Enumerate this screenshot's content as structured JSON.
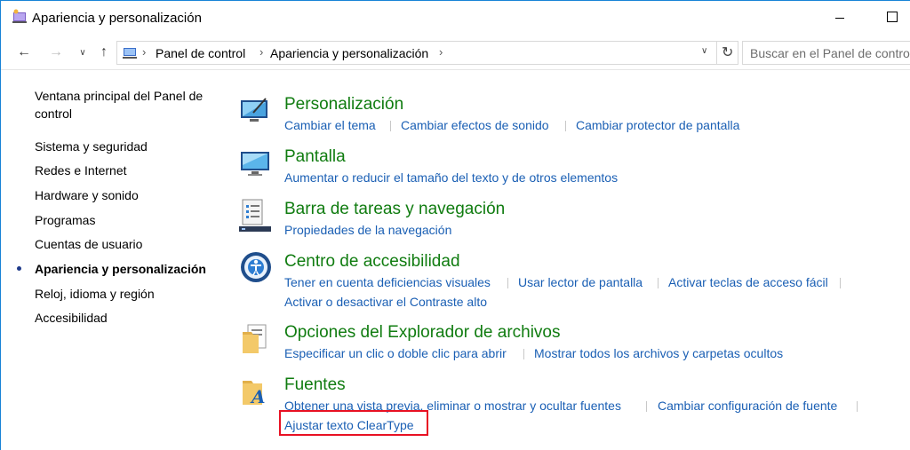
{
  "window": {
    "title": "Apariencia y personalización"
  },
  "address_bar": {
    "breadcrumbs": [
      "Panel de control",
      "Apariencia y personalización"
    ],
    "search_placeholder": "Buscar en el Panel de control"
  },
  "sidebar": {
    "home": "Ventana principal del Panel de control",
    "items": [
      {
        "label": "Sistema y seguridad",
        "current": false
      },
      {
        "label": "Redes e Internet",
        "current": false
      },
      {
        "label": "Hardware y sonido",
        "current": false
      },
      {
        "label": "Programas",
        "current": false
      },
      {
        "label": "Cuentas de usuario",
        "current": false
      },
      {
        "label": "Apariencia y personalización",
        "current": true
      },
      {
        "label": "Reloj, idioma y región",
        "current": false
      },
      {
        "label": "Accesibilidad",
        "current": false
      }
    ]
  },
  "groups": [
    {
      "title": "Personalización",
      "icon": "personalization-icon",
      "links": [
        [
          "Cambiar el tema",
          "Cambiar efectos de sonido",
          "Cambiar protector de pantalla"
        ]
      ]
    },
    {
      "title": "Pantalla",
      "icon": "display-icon",
      "links": [
        [
          "Aumentar o reducir el tamaño del texto y de otros elementos"
        ]
      ]
    },
    {
      "title": "Barra de tareas y navegación",
      "icon": "taskbar-icon",
      "links": [
        [
          "Propiedades de la navegación"
        ]
      ]
    },
    {
      "title": "Centro de accesibilidad",
      "icon": "ease-of-access-icon",
      "links": [
        [
          "Tener en cuenta deficiencias visuales",
          "Usar lector de pantalla",
          "Activar teclas de acceso fácil"
        ],
        [
          "Activar o desactivar el Contraste alto"
        ]
      ]
    },
    {
      "title": "Opciones del Explorador de archivos",
      "icon": "file-explorer-options-icon",
      "links": [
        [
          "Especificar un clic o doble clic para abrir",
          "Mostrar todos los archivos y carpetas ocultos"
        ]
      ]
    },
    {
      "title": "Fuentes",
      "icon": "fonts-icon",
      "links": [
        [
          "Obtener una vista previa, eliminar o mostrar y ocultar fuentes",
          "Cambiar configuración de fuente"
        ],
        [
          "Ajustar texto ClearType"
        ]
      ]
    }
  ],
  "colors": {
    "group_title": "#107c10",
    "link": "#1a5fb4",
    "highlight": "#e81123"
  }
}
